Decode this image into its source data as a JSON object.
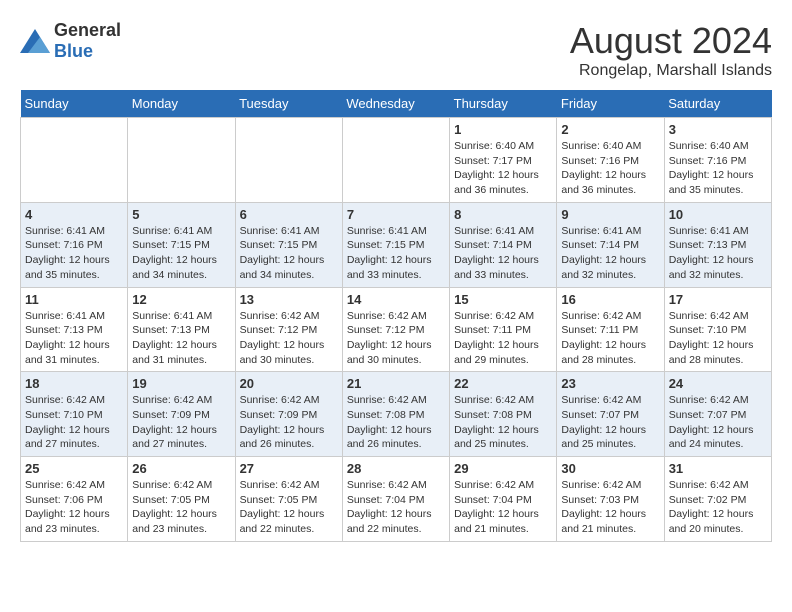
{
  "header": {
    "logo_general": "General",
    "logo_blue": "Blue",
    "main_title": "August 2024",
    "subtitle": "Rongelap, Marshall Islands"
  },
  "days_of_week": [
    "Sunday",
    "Monday",
    "Tuesday",
    "Wednesday",
    "Thursday",
    "Friday",
    "Saturday"
  ],
  "weeks": [
    [
      {
        "day": "",
        "info": ""
      },
      {
        "day": "",
        "info": ""
      },
      {
        "day": "",
        "info": ""
      },
      {
        "day": "",
        "info": ""
      },
      {
        "day": "1",
        "info": "Sunrise: 6:40 AM\nSunset: 7:17 PM\nDaylight: 12 hours\nand 36 minutes."
      },
      {
        "day": "2",
        "info": "Sunrise: 6:40 AM\nSunset: 7:16 PM\nDaylight: 12 hours\nand 36 minutes."
      },
      {
        "day": "3",
        "info": "Sunrise: 6:40 AM\nSunset: 7:16 PM\nDaylight: 12 hours\nand 35 minutes."
      }
    ],
    [
      {
        "day": "4",
        "info": "Sunrise: 6:41 AM\nSunset: 7:16 PM\nDaylight: 12 hours\nand 35 minutes."
      },
      {
        "day": "5",
        "info": "Sunrise: 6:41 AM\nSunset: 7:15 PM\nDaylight: 12 hours\nand 34 minutes."
      },
      {
        "day": "6",
        "info": "Sunrise: 6:41 AM\nSunset: 7:15 PM\nDaylight: 12 hours\nand 34 minutes."
      },
      {
        "day": "7",
        "info": "Sunrise: 6:41 AM\nSunset: 7:15 PM\nDaylight: 12 hours\nand 33 minutes."
      },
      {
        "day": "8",
        "info": "Sunrise: 6:41 AM\nSunset: 7:14 PM\nDaylight: 12 hours\nand 33 minutes."
      },
      {
        "day": "9",
        "info": "Sunrise: 6:41 AM\nSunset: 7:14 PM\nDaylight: 12 hours\nand 32 minutes."
      },
      {
        "day": "10",
        "info": "Sunrise: 6:41 AM\nSunset: 7:13 PM\nDaylight: 12 hours\nand 32 minutes."
      }
    ],
    [
      {
        "day": "11",
        "info": "Sunrise: 6:41 AM\nSunset: 7:13 PM\nDaylight: 12 hours\nand 31 minutes."
      },
      {
        "day": "12",
        "info": "Sunrise: 6:41 AM\nSunset: 7:13 PM\nDaylight: 12 hours\nand 31 minutes."
      },
      {
        "day": "13",
        "info": "Sunrise: 6:42 AM\nSunset: 7:12 PM\nDaylight: 12 hours\nand 30 minutes."
      },
      {
        "day": "14",
        "info": "Sunrise: 6:42 AM\nSunset: 7:12 PM\nDaylight: 12 hours\nand 30 minutes."
      },
      {
        "day": "15",
        "info": "Sunrise: 6:42 AM\nSunset: 7:11 PM\nDaylight: 12 hours\nand 29 minutes."
      },
      {
        "day": "16",
        "info": "Sunrise: 6:42 AM\nSunset: 7:11 PM\nDaylight: 12 hours\nand 28 minutes."
      },
      {
        "day": "17",
        "info": "Sunrise: 6:42 AM\nSunset: 7:10 PM\nDaylight: 12 hours\nand 28 minutes."
      }
    ],
    [
      {
        "day": "18",
        "info": "Sunrise: 6:42 AM\nSunset: 7:10 PM\nDaylight: 12 hours\nand 27 minutes."
      },
      {
        "day": "19",
        "info": "Sunrise: 6:42 AM\nSunset: 7:09 PM\nDaylight: 12 hours\nand 27 minutes."
      },
      {
        "day": "20",
        "info": "Sunrise: 6:42 AM\nSunset: 7:09 PM\nDaylight: 12 hours\nand 26 minutes."
      },
      {
        "day": "21",
        "info": "Sunrise: 6:42 AM\nSunset: 7:08 PM\nDaylight: 12 hours\nand 26 minutes."
      },
      {
        "day": "22",
        "info": "Sunrise: 6:42 AM\nSunset: 7:08 PM\nDaylight: 12 hours\nand 25 minutes."
      },
      {
        "day": "23",
        "info": "Sunrise: 6:42 AM\nSunset: 7:07 PM\nDaylight: 12 hours\nand 25 minutes."
      },
      {
        "day": "24",
        "info": "Sunrise: 6:42 AM\nSunset: 7:07 PM\nDaylight: 12 hours\nand 24 minutes."
      }
    ],
    [
      {
        "day": "25",
        "info": "Sunrise: 6:42 AM\nSunset: 7:06 PM\nDaylight: 12 hours\nand 23 minutes."
      },
      {
        "day": "26",
        "info": "Sunrise: 6:42 AM\nSunset: 7:05 PM\nDaylight: 12 hours\nand 23 minutes."
      },
      {
        "day": "27",
        "info": "Sunrise: 6:42 AM\nSunset: 7:05 PM\nDaylight: 12 hours\nand 22 minutes."
      },
      {
        "day": "28",
        "info": "Sunrise: 6:42 AM\nSunset: 7:04 PM\nDaylight: 12 hours\nand 22 minutes."
      },
      {
        "day": "29",
        "info": "Sunrise: 6:42 AM\nSunset: 7:04 PM\nDaylight: 12 hours\nand 21 minutes."
      },
      {
        "day": "30",
        "info": "Sunrise: 6:42 AM\nSunset: 7:03 PM\nDaylight: 12 hours\nand 21 minutes."
      },
      {
        "day": "31",
        "info": "Sunrise: 6:42 AM\nSunset: 7:02 PM\nDaylight: 12 hours\nand 20 minutes."
      }
    ]
  ]
}
